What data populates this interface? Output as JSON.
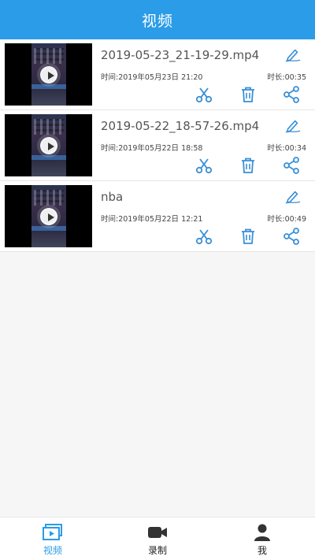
{
  "header": {
    "title": "视频"
  },
  "videos": [
    {
      "name": "2019-05-23_21-19-29.mp4",
      "time": "时间:2019年05月23日 21:20",
      "duration": "时长:00:35"
    },
    {
      "name": "2019-05-22_18-57-26.mp4",
      "time": "时间:2019年05月22日 18:58",
      "duration": "时长:00:34"
    },
    {
      "name": "nba",
      "time": "时间:2019年05月22日 12:21",
      "duration": "时长:00:49"
    }
  ],
  "icons": {
    "edit": "pencil-edit-icon",
    "cut": "scissors-icon",
    "delete": "trash-icon",
    "share": "share-icon",
    "tab_video": "video-screen-icon",
    "tab_record": "camera-icon",
    "tab_me": "user-icon"
  },
  "tabbar": {
    "tabs": [
      {
        "label": "视频",
        "active": true
      },
      {
        "label": "录制",
        "active": false
      },
      {
        "label": "我",
        "active": false
      }
    ]
  },
  "colors": {
    "accent": "#2a9ce8",
    "icon_blue": "#3a8fd6",
    "text_primary": "#555555",
    "text_secondary": "#444444",
    "background": "#f6f6f6"
  }
}
